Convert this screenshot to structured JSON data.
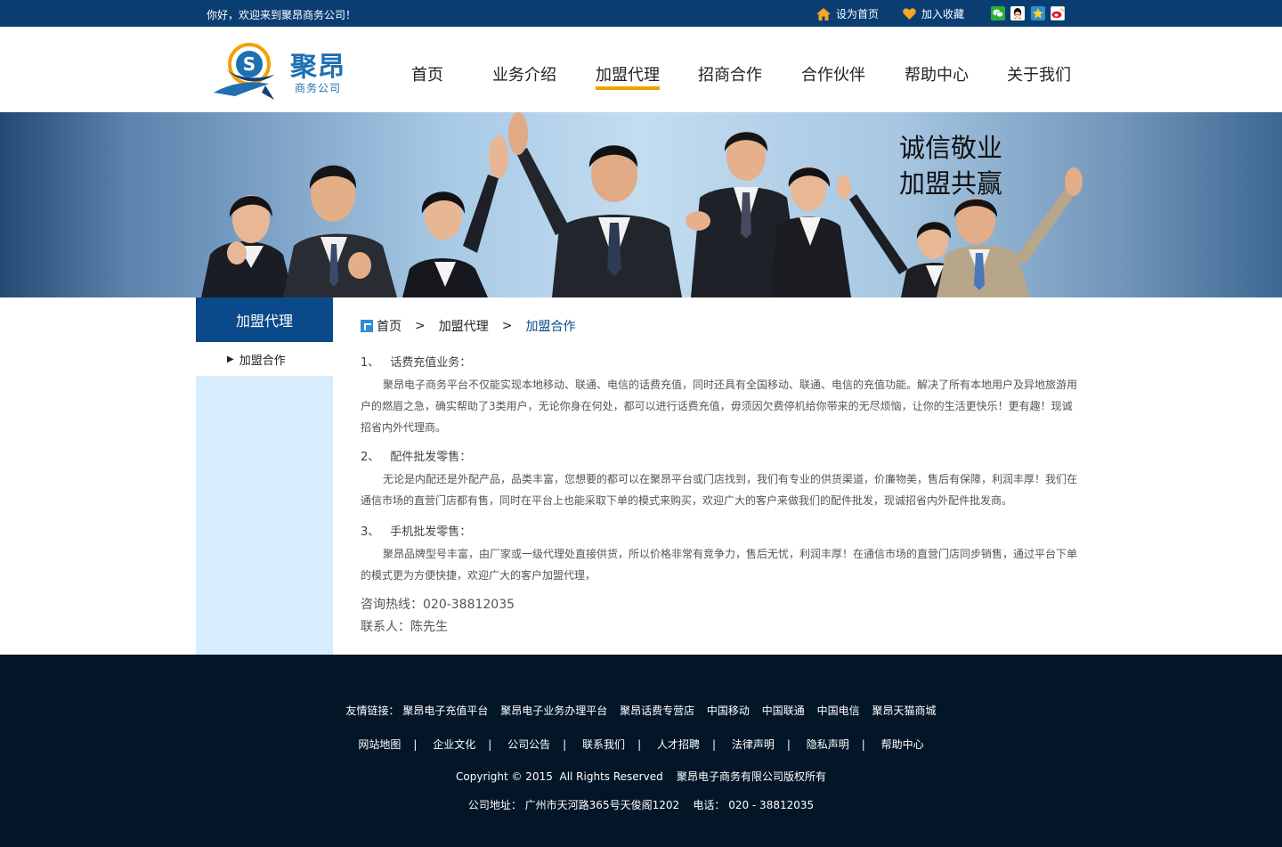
{
  "topbar": {
    "welcome": "你好，欢迎来到聚昂商务公司！",
    "set_home": "设为首页",
    "add_favorite": "加入收藏",
    "social_icons": [
      "wechat-icon",
      "qq-icon",
      "qzone-icon",
      "weibo-icon"
    ],
    "bg_color": "#0a3e73"
  },
  "logo": {
    "brand": "聚昂",
    "sub": "商务公司"
  },
  "nav": [
    "首页",
    "业务介绍",
    "加盟代理",
    "招商合作",
    "合作伙伴",
    "帮助中心",
    "关于我们"
  ],
  "nav_active": "加盟代理",
  "banner": {
    "slogan_1": "诚信敬业",
    "slogan_2": "加盟共赢"
  },
  "sidebar": {
    "title": "加盟代理",
    "items": [
      "加盟合作"
    ]
  },
  "breadcrumb": {
    "home": "首页",
    "sep": ">",
    "level1": "加盟代理",
    "current": "加盟合作"
  },
  "sections": [
    {
      "num": "1、",
      "title": "话费充值业务：",
      "body": "聚昂电子商务平台不仅能实现本地移动、联通、电信的话费充值，同时还具有全国移动、联通、电信的充值功能。解决了所有本地用户及异地旅游用户的燃眉之急，确实帮助了3类用户，无论你身在何处，都可以进行话费充值，毋须因欠费停机给你带来的无尽烦恼，让你的生活更快乐！更有趣！现诚招省内外代理商。"
    },
    {
      "num": "2、",
      "title": "配件批发零售：",
      "body": "无论是内配还是外配产品，品类丰富，您想要的都可以在聚昂平台或门店找到，我们有专业的供货渠道，价廉物美，售后有保障，利润丰厚！我们在通信市场的直营门店都有售，同时在平台上也能采取下单的模式来购买，欢迎广大的客户来做我们的配件批发，现诚招省内外配件批发商。"
    },
    {
      "num": "3、",
      "title": "手机批发零售：",
      "body": "聚昂品牌型号丰富，由厂家或一级代理处直接供货，所以价格非常有竞争力，售后无忧，利润丰厚！在通信市场的直营门店同步销售，通过平台下单的模式更为方便快捷，欢迎广大的客户加盟代理，"
    }
  ],
  "contact": {
    "hotline": "咨询热线：020-38812035",
    "person": "联系人：陈先生"
  },
  "footer": {
    "friend_label": "友情链接：",
    "friend_links": [
      "聚昂电子充值平台",
      "聚昂电子业务办理平台",
      "聚昂话费专营店",
      "中国移动",
      "中国联通",
      "中国电信",
      "聚昂天猫商城"
    ],
    "site_links": [
      "网站地图",
      "企业文化",
      "公司公告",
      "联系我们",
      "人才招聘",
      "法律声明",
      "隐私声明",
      "帮助中心"
    ],
    "separator": "|",
    "copyright": "Copyright © 2015  All Rights Reserved    聚昂电子商务有限公司版权所有",
    "address": "公司地址： 广州市天河路365号天俊阁1202    电话： 020 - 38812035",
    "bg_color": "#021628"
  }
}
